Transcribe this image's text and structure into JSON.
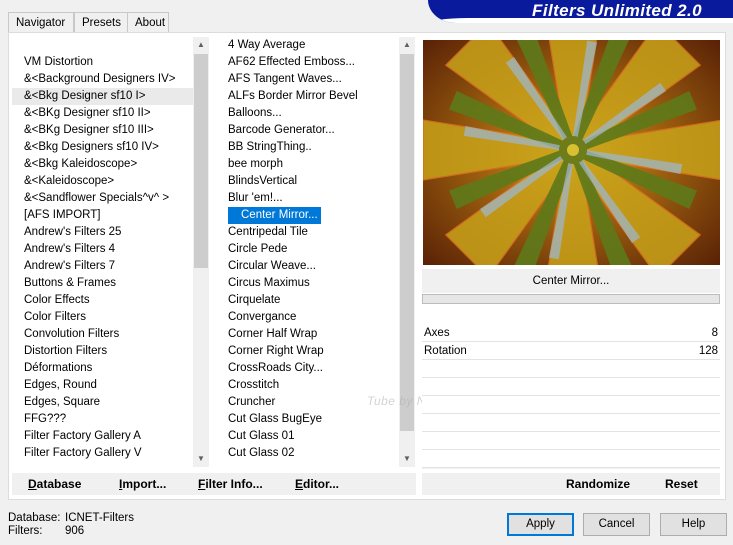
{
  "tabs": [
    "Navigator",
    "Presets",
    "About"
  ],
  "app_title": "Filters Unlimited 2.0",
  "categories": [
    " VM Distortion",
    "&<Background Designers IV>",
    "&<Bkg Designer sf10 I>",
    "&<BKg Designer sf10 II>",
    "&<BKg Designer sf10 III>",
    "&<Bkg Designers sf10 IV>",
    "&<Bkg Kaleidoscope>",
    "&<Kaleidoscope>",
    "&<Sandflower Specials^v^ >",
    "[AFS IMPORT]",
    "Andrew's Filters 25",
    "Andrew's Filters 4",
    "Andrew's Filters 7",
    "Buttons & Frames",
    "Color Effects",
    "Color Filters",
    "Convolution Filters",
    "Distortion Filters",
    "Déformations",
    "Edges, Round",
    "Edges, Square",
    "FFG???",
    "Filter Factory Gallery A",
    "Filter Factory Gallery V"
  ],
  "filters": [
    "4 Way Average",
    "AF62 Effected Emboss...",
    "AFS Tangent Waves...",
    "ALFs Border Mirror Bevel",
    "Balloons...",
    "Barcode Generator...",
    "BB StringThing..",
    "bee morph",
    "BlindsVertical",
    "Blur 'em!...",
    "Center Mirror...",
    "Centripedal Tile",
    "Circle Pede",
    "Circular Weave...",
    "Circus Maximus",
    "Cirquelate",
    "Convergance",
    "Corner Half Wrap",
    "Corner Right Wrap",
    "CrossRoads City...",
    "Crosstitch",
    "Cruncher",
    "Cut Glass  BugEye",
    "Cut Glass 01",
    "Cut Glass 02"
  ],
  "selected_filter": "Center Mirror...",
  "params": [
    {
      "name": "Axes",
      "value": "8"
    },
    {
      "name": "Rotation",
      "value": "128"
    }
  ],
  "left_buttons": {
    "database": {
      "u": "D",
      "rest": "atabase"
    },
    "import": {
      "u": "I",
      "rest": "mport..."
    },
    "filter_info": {
      "u": "F",
      "rest": "ilter Info..."
    },
    "editor": {
      "u": "E",
      "rest": "ditor..."
    }
  },
  "right_buttons": {
    "randomize": "Randomize",
    "reset": "Reset"
  },
  "status": {
    "database_label": "Database:",
    "database_value": "ICNET-Filters",
    "filters_label": "Filters:",
    "filters_value": "906"
  },
  "dialog_buttons": {
    "apply": "Apply",
    "cancel": "Cancel",
    "help": "Help"
  },
  "watermark": "Tube by Neusa Novaes",
  "colors": {
    "banner": "#0a1a9c",
    "selection": "#0078d7"
  }
}
